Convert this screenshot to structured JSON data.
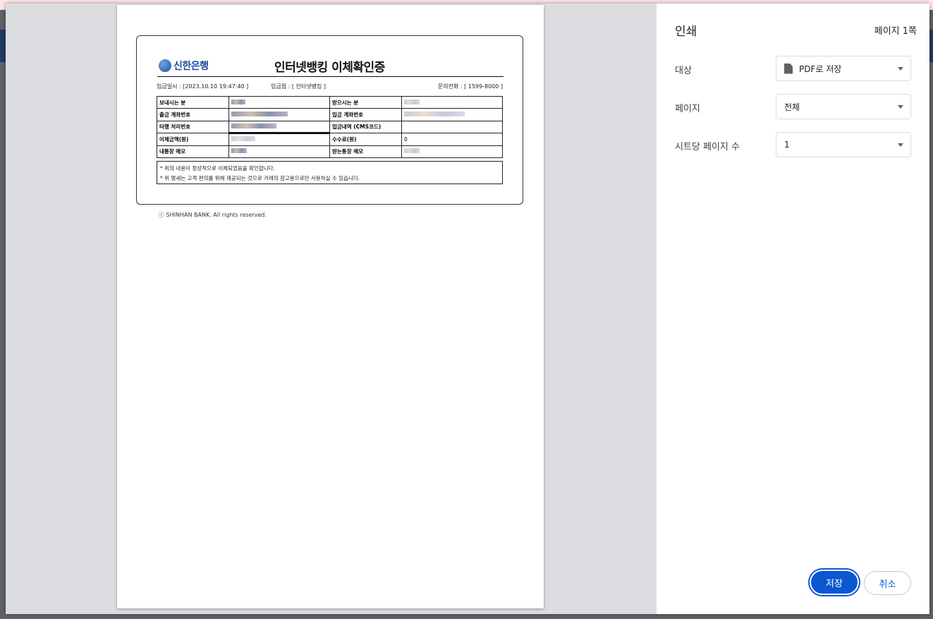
{
  "receipt": {
    "bank_name": "신한은행",
    "title": "인터넷뱅킹 이체확인증",
    "deposit_date": "입금일시 : [2023.10.10 19:47:40 ]",
    "branch": "입금점 : [ 인터넷뱅킹 ]",
    "phone": "문의전화 : [ 1599-8000 ]",
    "rows": [
      {
        "left_label": "보내시는 분",
        "right_label": "받으시는 분",
        "right_value": ""
      },
      {
        "left_label": "출금 계좌번호",
        "right_label": "입금 계좌번호",
        "right_value": ""
      },
      {
        "left_label": "타행 처리번호",
        "right_label": "입금내역 (CMS코드)",
        "right_value": ""
      },
      {
        "left_label": "이체금액(원)",
        "right_label": "수수료(원)",
        "right_value": "0"
      },
      {
        "left_label": "내통장 메모",
        "right_label": "받는통장 메모",
        "right_value": ""
      }
    ],
    "note1": "* 위의 내용이 정상적으로 이체되었음을 확인합니다.",
    "note2": "* 위 명세는 고객 편의를 위해 제공되는 것으로 거래의 참고용으로만 사용하실 수 있습니다.",
    "copyright": "ⓒ SHINHAN BANK. All rights reserved."
  },
  "panel": {
    "title": "인쇄",
    "page_count": "페이지 1쪽",
    "destination_label": "대상",
    "destination_value": "PDF로 저장",
    "pages_label": "페이지",
    "pages_value": "전체",
    "pages_per_sheet_label": "시트당 페이지 수",
    "pages_per_sheet_value": "1",
    "save_label": "저장",
    "cancel_label": "취소"
  },
  "colors": {
    "primary": "#0b57d0",
    "bank_blue": "#1a4b9b"
  }
}
